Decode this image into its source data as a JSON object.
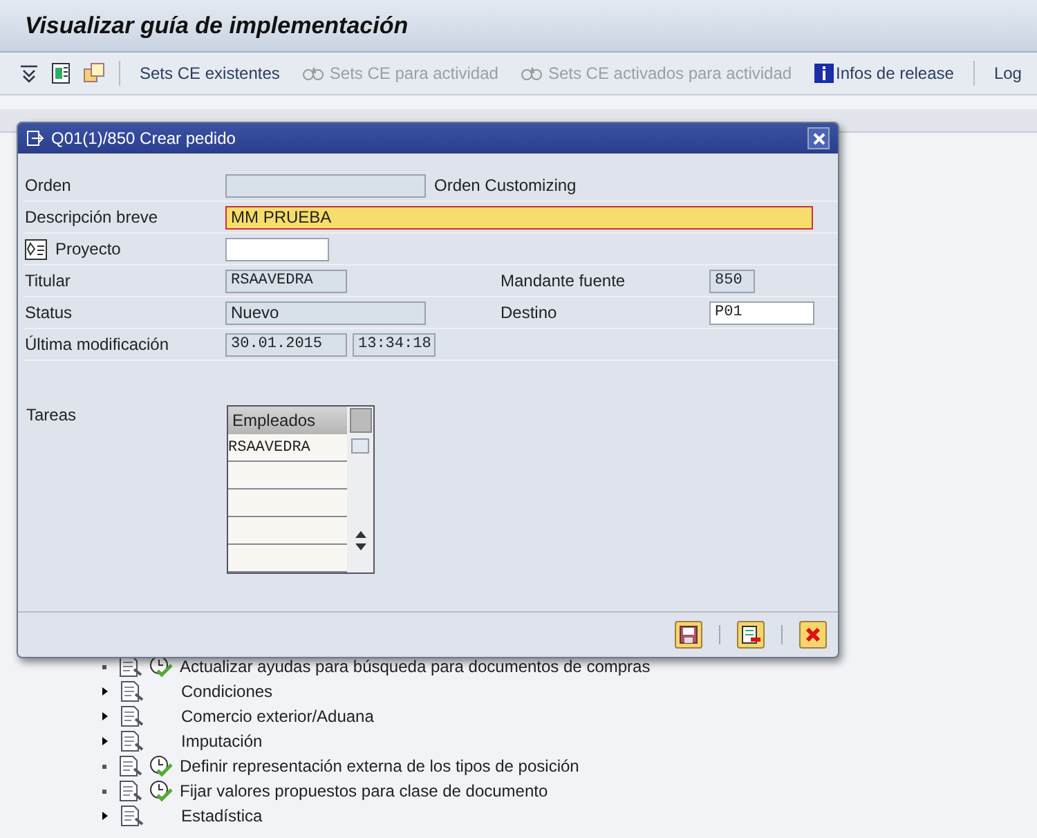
{
  "page": {
    "title": "Visualizar guía de implementación"
  },
  "toolbar": [
    {
      "label": "Sets CE existentes",
      "kind": "plain",
      "disabled": false
    },
    {
      "label": "Sets CE para actividad",
      "kind": "activity",
      "disabled": true
    },
    {
      "label": "Sets CE activados para actividad",
      "kind": "activity",
      "disabled": true
    },
    {
      "label": "Infos de release",
      "kind": "info",
      "disabled": false
    },
    {
      "label": "Log",
      "kind": "plain",
      "disabled": false
    }
  ],
  "dialog": {
    "title": "Q01(1)/850 Crear pedido",
    "fields": [
      {
        "label": "Orden",
        "editable": false,
        "focused": false,
        "note": "Orden Customizing"
      },
      {
        "label": "Descripción breve",
        "value": "MM PRUEBA",
        "editable": true,
        "focused": true
      },
      {
        "label": "Proyecto",
        "editable": true,
        "focused": false,
        "kind": "project"
      },
      {
        "label": "Titular",
        "value": "RSAAVEDRA",
        "editable": false,
        "focused": false
      },
      {
        "label": "Status",
        "value": "Nuevo",
        "editable": false,
        "focused": false
      },
      {
        "label": "Última modificación",
        "value": "30.01.2015",
        "value_2": "13:34:18",
        "editable": false,
        "focused": false
      }
    ],
    "right_fields": [
      {
        "label": "Mandante fuente",
        "value": "850",
        "editable": false
      },
      {
        "label": "Destino",
        "value": "P01",
        "editable": true
      }
    ],
    "tasks": {
      "label": "Tareas",
      "column": "Empleados",
      "rows": [
        "RSAAVEDRA"
      ]
    }
  },
  "tree": [
    {
      "label": "Actualizar ayudas para búsqueda para documentos de compras",
      "kind": "activity"
    },
    {
      "label": "Condiciones",
      "kind": "folder"
    },
    {
      "label": "Comercio exterior/Aduana",
      "kind": "folder"
    },
    {
      "label": "Imputación",
      "kind": "folder"
    },
    {
      "label": "Definir representación externa de los tipos de posición",
      "kind": "activity"
    },
    {
      "label": "Fijar valores propuestos para clase de documento",
      "kind": "activity"
    },
    {
      "label": "Estadística",
      "kind": "folder"
    }
  ]
}
